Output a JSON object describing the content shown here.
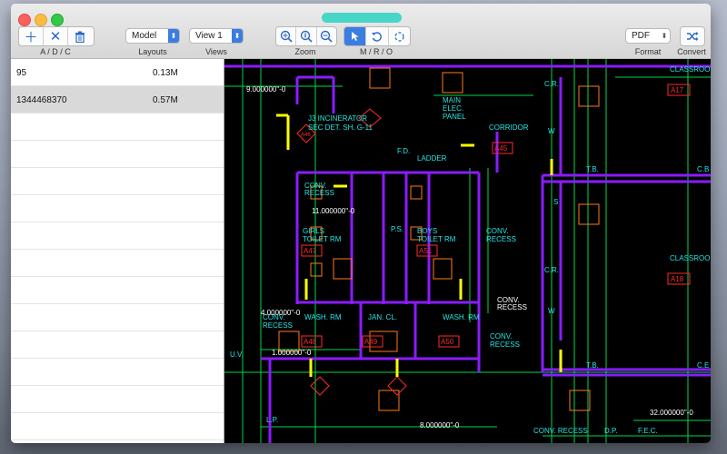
{
  "toolbar": {
    "add_remove_label": "A / D / C",
    "layouts_label": "Layouts",
    "layouts_value": "Model",
    "views_label": "Views",
    "views_value": "View 1",
    "zoom_label": "Zoom",
    "mro_label": "M / R / O",
    "format_label": "Format",
    "format_value": "PDF",
    "convert_label": "Convert"
  },
  "files": [
    {
      "name": "95",
      "size": "0.13M"
    },
    {
      "name": "1344468370",
      "size": "0.57M"
    }
  ],
  "drawing": {
    "labels": {
      "classroom_a17": "CLASSROOM",
      "a17": "A17",
      "classroom_a18": "CLASSROOM",
      "a18": "A18",
      "incinerator": "J3 INCINERATOR",
      "sec_det": "SEC DET. SH. G-11",
      "main_elec": "MAIN",
      "main_elec2": "ELEC.",
      "main_elec3": "PANEL",
      "corridor": "CORRIDOR",
      "cr1": "C.R.",
      "cr2": "C.R.",
      "fd": "F.D.",
      "ladder": "LADDER",
      "a46": "A46",
      "a45": "A45",
      "conv_recess1": "CONV.",
      "conv_recess1b": "RECESS",
      "girls": "GIRLS",
      "girls2": "TOILET RM",
      "a47": "A47",
      "boys": "BOYS",
      "boys2": "TOILET RM",
      "a51": "A51",
      "ps": "P.S.",
      "conv_recess2": "CONV.",
      "conv_recess2b": "RECESS",
      "conv_recess3": "CONV.",
      "conv_recess3b": "RECESS",
      "wash1": "WASH. RM",
      "a48": "A48",
      "jan": "JAN. CL.",
      "a49": "A49",
      "wash2": "WASH. RM",
      "a50": "A50",
      "conv_recess4": "CONV.",
      "conv_recess4b": "RECESS",
      "conv_recess5": "CONV.",
      "conv_recess5b": "RECESS",
      "conv_recess6": "CONV. RECESS",
      "dp": "D.P.",
      "fec": "F.E.C.",
      "tb1": "T.B.",
      "tb2": "T.B.",
      "uv": "U.V.",
      "lp": "L.P.",
      "dim1": "32.000000\"-0",
      "dim2": "8.000000\"-0",
      "dim3": "11.000000\"-0",
      "dim4": "1.000000\"-0",
      "dim5": "9.000000\"-0",
      "dim6": "4.000000\"-0",
      "w1": "W",
      "w2": "W",
      "s": "S",
      "cb": "C.B",
      "cb2": "C.E"
    }
  },
  "colors": {
    "accent": "#3b7de0",
    "title_pill": "#47d6c8",
    "cad_wall": "#8a1cff",
    "cad_green": "#00d84a",
    "cad_red": "#ff2a2a",
    "cad_cyan": "#26e6e6",
    "cad_yellow": "#ffff00",
    "cad_orange": "#ff7a1a"
  }
}
